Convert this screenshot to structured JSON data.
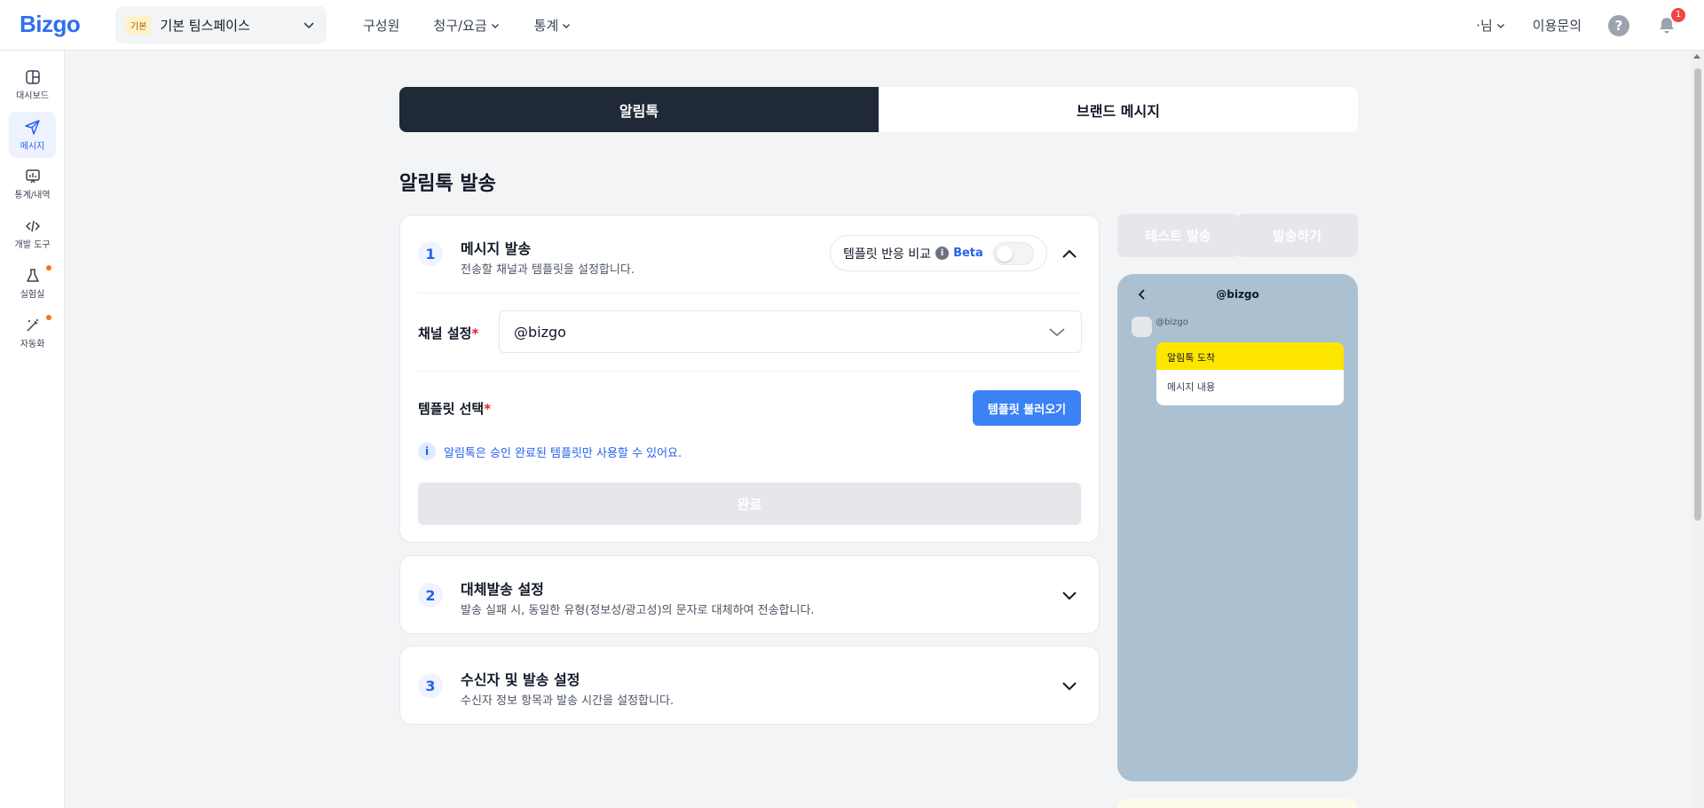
{
  "header": {
    "logo": "Bizgo",
    "workspace": {
      "badge": "기본",
      "name": "기본 팀스페이스"
    },
    "nav": [
      {
        "label": "구성원"
      },
      {
        "label": "청구/요금"
      },
      {
        "label": "통계"
      }
    ],
    "user_label": "·님",
    "inquiry_label": "이용문의",
    "help_label": "?",
    "notification_count": "1"
  },
  "sidebar": {
    "items": [
      {
        "label": "대시보드",
        "icon": "dashboard-icon"
      },
      {
        "label": "메시지",
        "icon": "send-icon",
        "active": true
      },
      {
        "label": "통계/내역",
        "icon": "chart-board-icon"
      },
      {
        "label": "개발 도구",
        "icon": "code-icon"
      },
      {
        "label": "실험실",
        "icon": "flask-icon",
        "dot": true
      },
      {
        "label": "자동화",
        "icon": "magic-wand-icon",
        "dot": true
      }
    ]
  },
  "tabs": [
    {
      "label": "알림톡",
      "active": true
    },
    {
      "label": "브랜드 메시지"
    }
  ],
  "page_title": "알림톡 발송",
  "section1": {
    "step": "1",
    "title": "메시지 발송",
    "description": "전송할 채널과 템플릿을 설정합니다.",
    "compare_label": "템플릿 반응 비교",
    "info_glyph": "i",
    "beta_label": "Beta",
    "channel_label": "채널 설정",
    "required_mark": "*",
    "channel_value": "@bizgo",
    "template_label": "템플릿 선택",
    "load_template_button": "템플릿 불러오기",
    "notice": "알림톡은 승인 완료된 템플릿만 사용할 수 있어요.",
    "done_button": "완료"
  },
  "section2": {
    "step": "2",
    "title": "대체발송 설정",
    "description": "발송 실패 시, 동일한 유형(정보성/광고성)의 문자로 대체하여 전송합니다."
  },
  "section3": {
    "step": "3",
    "title": "수신자 및 발송 설정",
    "description": "수신자 정보 항목과 발송 시간을 설정합니다."
  },
  "actions": {
    "test_send": "테스트 발송",
    "send": "발송하기"
  },
  "preview": {
    "channel_title": "@bizgo",
    "sender": "@bizgo",
    "bubble_header": "알림톡 도착",
    "bubble_body": "메시지 내용"
  },
  "colors": {
    "brand": "#2f6fea",
    "active_tab": "#1f2937",
    "primary_button": "#3b82f6",
    "kakao_yellow": "#fee500",
    "preview_bg": "#abc1d1"
  }
}
